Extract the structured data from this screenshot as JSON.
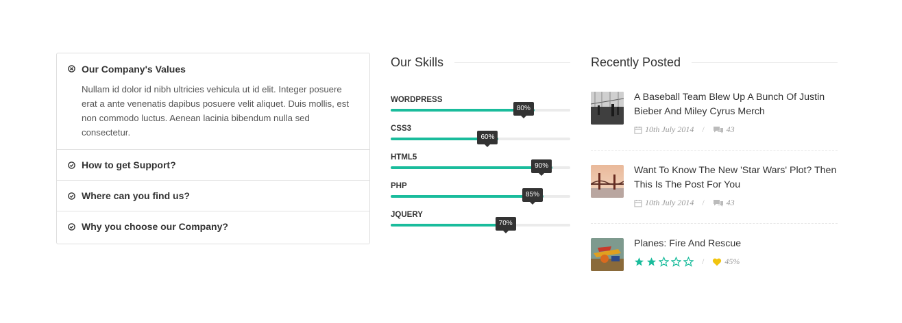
{
  "accordion": {
    "items": [
      {
        "title": "Our Company's Values",
        "body": "Nullam id dolor id nibh ultricies vehicula ut id elit. Integer posuere erat a ante venenatis dapibus posuere velit aliquet. Duis mollis, est non commodo luctus. Aenean lacinia bibendum nulla sed consectetur.",
        "expanded": true
      },
      {
        "title": "How to get Support?",
        "expanded": false
      },
      {
        "title": "Where can you find us?",
        "expanded": false
      },
      {
        "title": "Why you choose our Company?",
        "expanded": false
      }
    ]
  },
  "skills": {
    "heading": "Our Skills",
    "items": [
      {
        "label": "WORDPRESS",
        "value": 80,
        "tooltip": "80%"
      },
      {
        "label": "CSS3",
        "value": 60,
        "tooltip": "60%"
      },
      {
        "label": "HTML5",
        "value": 90,
        "tooltip": "90%"
      },
      {
        "label": "PHP",
        "value": 85,
        "tooltip": "85%"
      },
      {
        "label": "JQUERY",
        "value": 70,
        "tooltip": "70%"
      }
    ]
  },
  "recent": {
    "heading": "Recently Posted",
    "posts": [
      {
        "title": "A Baseball Team Blew Up A Bunch Of Justin Bieber And Miley Cyrus Merch",
        "date": "10th July 2014",
        "comments": "43",
        "thumb": "thumb-airport"
      },
      {
        "title": "Want To Know The New 'Star Wars' Plot? Then This Is The Post For You",
        "date": "10th July 2014",
        "comments": "43",
        "thumb": "thumb-bridge"
      },
      {
        "title": "Planes: Fire And Rescue",
        "rating_stars": 2,
        "rating_max": 5,
        "likes": "45%",
        "thumb": "thumb-plane"
      }
    ]
  },
  "colors": {
    "accent": "#1abc9c",
    "tooltip_bg": "#333333",
    "track": "#ebebeb",
    "like_heart": "#f1c40f",
    "meta_gray": "#999999"
  }
}
